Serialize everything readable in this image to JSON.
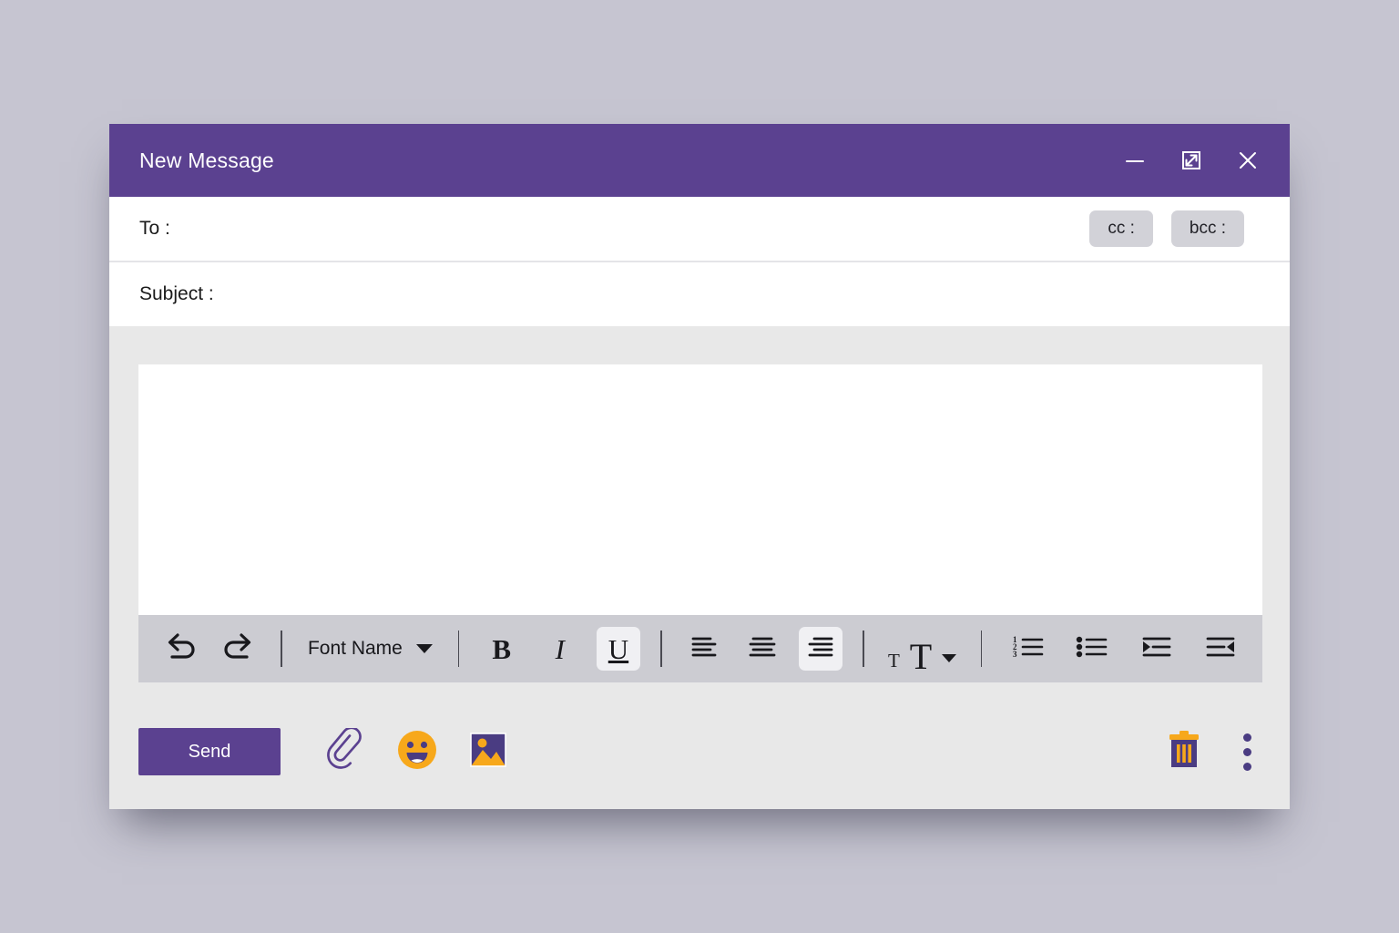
{
  "window": {
    "title": "New Message",
    "controls": [
      {
        "name": "minimize",
        "glyph": "minimize-icon"
      },
      {
        "name": "expand",
        "glyph": "expand-icon"
      },
      {
        "name": "close",
        "glyph": "close-icon"
      }
    ]
  },
  "fields": {
    "to": {
      "label": "To :",
      "value": "",
      "placeholder": ""
    },
    "cc": {
      "label": "cc :"
    },
    "bcc": {
      "label": "bcc :"
    },
    "subject": {
      "label": "Subject :",
      "value": "",
      "placeholder": ""
    },
    "body": {
      "value": "",
      "placeholder": ""
    }
  },
  "toolbar": {
    "undo": "undo-icon",
    "redo": "redo-icon",
    "font_name": "Font Name",
    "bold": "B",
    "italic": "I",
    "underline": "U",
    "align_left": "align-left-icon",
    "align_center": "align-center-icon",
    "align_right": "align-right-icon",
    "font_size_small": "T",
    "font_size_large": "T",
    "numbered_list": "numbered-list-icon",
    "bulleted_list": "bulleted-list-icon",
    "indent_increase": "indent-increase-icon",
    "indent_decrease": "indent-decrease-icon",
    "active": [
      "underline",
      "align_right"
    ]
  },
  "actions": {
    "send_label": "Send",
    "attach": "paperclip-icon",
    "emoji": "emoji-icon",
    "image": "image-icon",
    "discard": "trash-icon",
    "more": "more-options-icon"
  },
  "colors": {
    "accent_purple": "#5b4190",
    "accent_orange": "#f7a81b",
    "page_background": "#c6c5d1",
    "window_background": "#e8e8e8",
    "toolbar_background": "#ccccd2",
    "chip_background": "#d2d2d8"
  }
}
